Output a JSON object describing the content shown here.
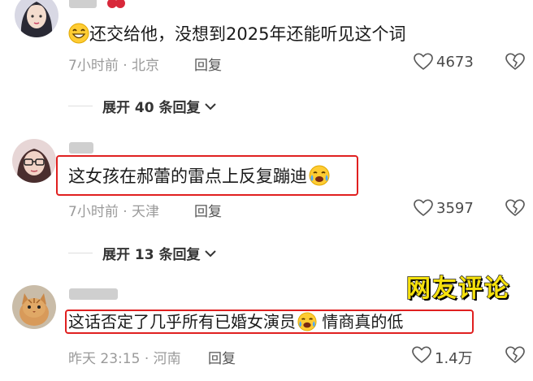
{
  "comments": [
    {
      "text": "还交给他，没想到2025年还能听见这个词",
      "time": "7小时前",
      "separator": "·",
      "location": "北京",
      "reply_label": "回复",
      "likes": "4673",
      "expand_label": "展开 40 条回复"
    },
    {
      "text": "这女孩在郝蕾的雷点上反复蹦迪",
      "time": "7小时前",
      "separator": "·",
      "location": "天津",
      "reply_label": "回复",
      "likes": "3597",
      "expand_label": "展开 13 条回复"
    },
    {
      "text_before": "这话否定了几乎所有已婚女演员",
      "text_after": "情商真的低",
      "time": "昨天 23:15",
      "separator": "·",
      "location": "河南",
      "reply_label": "回复",
      "likes": "1.4万"
    }
  ],
  "overlay_label": "网友评论",
  "colors": {
    "highlight_box": "#e02020",
    "overlay_text": "#f6e10c",
    "meta_text": "#9a9a9a"
  },
  "icons": [
    "heart-icon",
    "dislike-heart-icon",
    "chevron-down-icon",
    "grin-emoji-icon",
    "crying-laugh-emoji-icon"
  ]
}
